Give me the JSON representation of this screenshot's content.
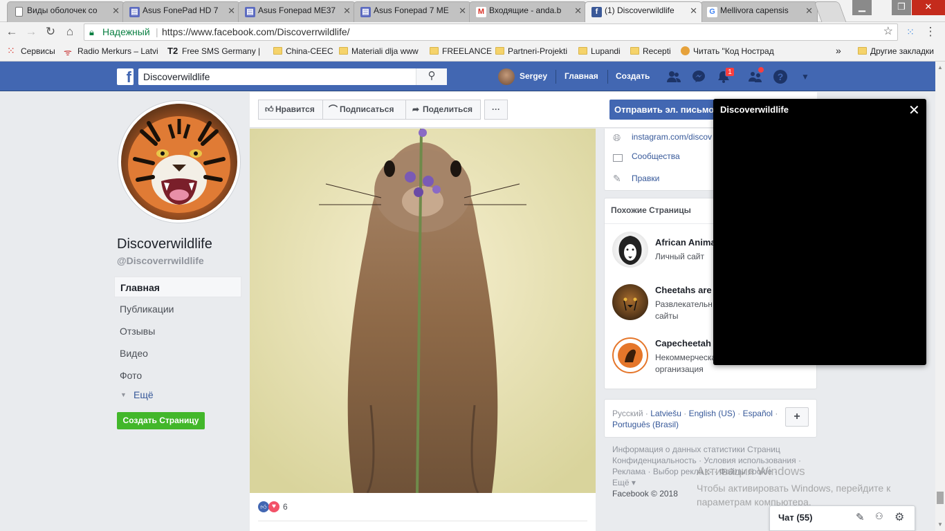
{
  "browser": {
    "tabs": [
      {
        "title": "Виды оболочек со",
        "icon": "document-icon"
      },
      {
        "title": "Asus FonePad HD 7",
        "icon": "forum-icon"
      },
      {
        "title": "Asus Fonepad ME37",
        "icon": "forum-icon"
      },
      {
        "title": "Asus Fonepad 7 ME",
        "icon": "forum-icon"
      },
      {
        "title": "Входящие - anda.b",
        "icon": "gmail-icon"
      },
      {
        "title": "(1) Discoverwildlife",
        "icon": "facebook-icon"
      },
      {
        "title": "Mellivora capensis",
        "icon": "google-icon"
      }
    ],
    "secure_label": "Надежный",
    "url": "https://www.facebook.com/Discoverrwildlife/",
    "bookmarks": [
      {
        "label": "Сервисы",
        "icon": "apps-icon"
      },
      {
        "label": "Radio Merkurs – Latvi",
        "icon": "radio-icon"
      },
      {
        "label": "Free SMS Germany | F",
        "icon": "t2-icon"
      },
      {
        "label": "China-CEEC",
        "icon": "folder-icon"
      },
      {
        "label": "Materiali dlja www",
        "icon": "folder-icon"
      },
      {
        "label": "FREELANCE",
        "icon": "folder-icon"
      },
      {
        "label": "Partneri-Projekti",
        "icon": "folder-icon"
      },
      {
        "label": "Lupandi",
        "icon": "folder-icon"
      },
      {
        "label": "Recepti",
        "icon": "folder-icon"
      },
      {
        "label": "Читать \"Код Нострад",
        "icon": "book-icon"
      }
    ],
    "more_bookmarks": "»",
    "other_bookmarks": "Другие закладки"
  },
  "fb": {
    "search_value": "Discoverwildlife",
    "user_name": "Sergey",
    "nav_home": "Главная",
    "nav_create": "Создать",
    "notif_count": "1",
    "colors": {
      "brand": "#4267b2",
      "green": "#42b72a"
    }
  },
  "page": {
    "name": "Discoverwildlife",
    "handle": "@Discoverrwildlife",
    "nav": [
      "Главная",
      "Публикации",
      "Отзывы",
      "Видео",
      "Фото"
    ],
    "more": "Ещё",
    "create_page": "Создать Страницу"
  },
  "actions": {
    "like": "Нравится",
    "follow": "Подписаться",
    "share": "Поделиться",
    "more": "···",
    "send_email": "Отправить эл. письмо"
  },
  "post": {
    "reaction_count": "6"
  },
  "about": {
    "instagram": "instagram.com/discov",
    "community": "Сообщества",
    "edits": "Правки"
  },
  "similar": {
    "title": "Похожие Страницы",
    "items": [
      {
        "name": "African Anima",
        "sub": "Личный сайт"
      },
      {
        "name": "Cheetahs are",
        "sub": "Развлекательн сайты"
      },
      {
        "name": "Capecheetah",
        "sub": "Некоммерческа организация"
      }
    ]
  },
  "languages": {
    "current": "Русский",
    "others": [
      "Latviešu",
      "English (US)",
      "Español",
      "Português (Brasil)"
    ],
    "add": "+"
  },
  "footer": {
    "line1": "Информация о данных статистики Страниц",
    "line2a": "Конфиденциальность",
    "line2b": "Условия использования",
    "line3a": "Реклама",
    "line3b": "Выбор рекла",
    "line3c": "Файлы cookie",
    "more": "Ещё",
    "copyright": "Facebook © 2018"
  },
  "popup": {
    "title": "Discoverwildlife"
  },
  "chat": {
    "label": "Чат (55)"
  },
  "watermark": {
    "line1": "Активация Windows",
    "line2": "Чтобы активировать Windows, перейдите к параметрам компьютера."
  }
}
